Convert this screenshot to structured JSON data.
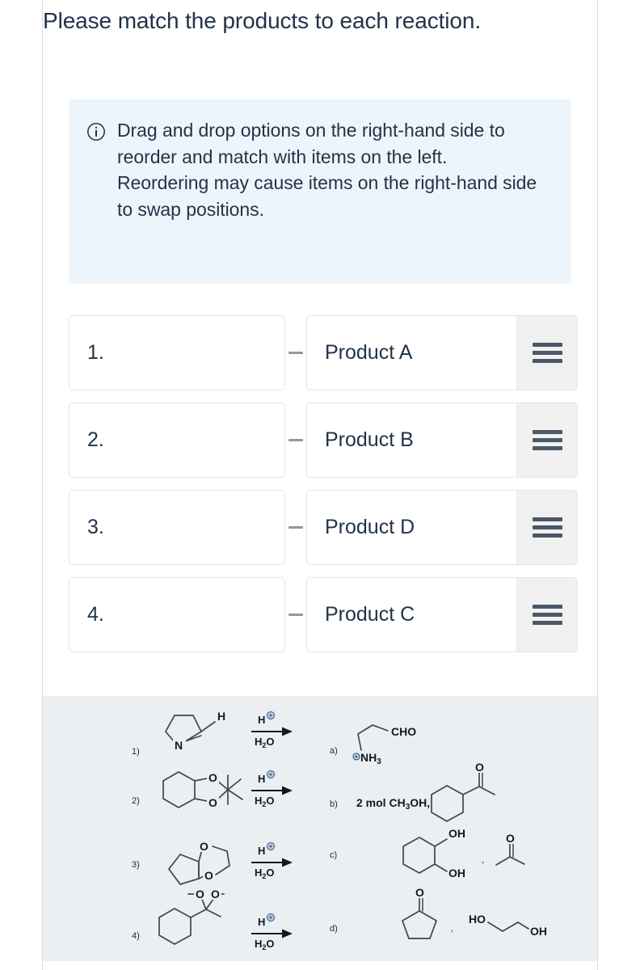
{
  "prompt": "Please match the products to each reaction.",
  "callout": {
    "icon": "info-circle-icon",
    "line1": "Drag and drop options on the right-hand side to reorder and match with items on the left.",
    "line2": "Reordering may cause items on the right-hand side to swap positions."
  },
  "match_rows": [
    {
      "number": "1.",
      "answer": "",
      "product": "Product A",
      "handle": "drag-handle"
    },
    {
      "number": "2.",
      "answer": "",
      "product": "Product B",
      "handle": "drag-handle"
    },
    {
      "number": "3.",
      "answer": "",
      "product": "Product D",
      "handle": "drag-handle"
    },
    {
      "number": "4.",
      "answer": "",
      "product": "Product C",
      "handle": "drag-handle"
    }
  ],
  "figure": {
    "reactions": [
      {
        "label": "1)",
        "substrate": "cyclic imine (3,4-dihydro-2H-pyrrole) with aldehyde H",
        "atoms": {
          "n": "N",
          "h": "H"
        },
        "reagent_top": "H",
        "reagent_top_charge": "+",
        "reagent_bottom": "H2O"
      },
      {
        "label": "2)",
        "substrate": "cyclohexane-fused 2,2-dimethyl-1,3-dioxolane",
        "atoms": {
          "o_top": "O",
          "o_bottom": "O"
        },
        "reagent_top": "H",
        "reagent_top_charge": "+",
        "reagent_bottom": "H2O"
      },
      {
        "label": "3)",
        "substrate": "cyclopentanone ethylene ketal (1,4-dioxaspiro[4.4]nonane)",
        "atoms": {
          "o_top": "O",
          "o_bottom": "O"
        },
        "reagent_top": "H",
        "reagent_top_charge": "+",
        "reagent_bottom": "H2O"
      },
      {
        "label": "4)",
        "substrate": "cyclohexyl dimethyl ketal",
        "atoms": {
          "o_left": "O",
          "o_right": "O"
        },
        "reagent_top": "H",
        "reagent_top_charge": "+",
        "reagent_bottom": "H2O"
      }
    ],
    "products": [
      {
        "label": "a)",
        "description": "4-ammoniobutanal",
        "atoms": {
          "cho": "CHO",
          "nh3": "NH3",
          "charge": "+"
        }
      },
      {
        "label": "b)",
        "description": "2 mol methanol plus cyclohexyl methyl ketone",
        "text": "2 mol CH3OH,",
        "atoms": {
          "o": "O"
        }
      },
      {
        "label": "c)",
        "description": "cyclohexane-1,2-diol plus acetone",
        "atoms": {
          "oh_top": "OH",
          "oh_bottom": "OH",
          "o": "O"
        },
        "separator": ","
      },
      {
        "label": "d)",
        "description": "cyclopentanone plus ethylene glycol",
        "atoms": {
          "o": "O",
          "ho": "HO",
          "oh": "OH"
        },
        "separator": ","
      }
    ]
  },
  "colors": {
    "text": "#223349",
    "callout_bg": "#edf5fc",
    "figure_bg": "#eceff1",
    "handle_bg": "#f1f1f1",
    "handle_bar": "#4a5868",
    "border": "#e2e4e8",
    "connector": "#8e99a6"
  }
}
